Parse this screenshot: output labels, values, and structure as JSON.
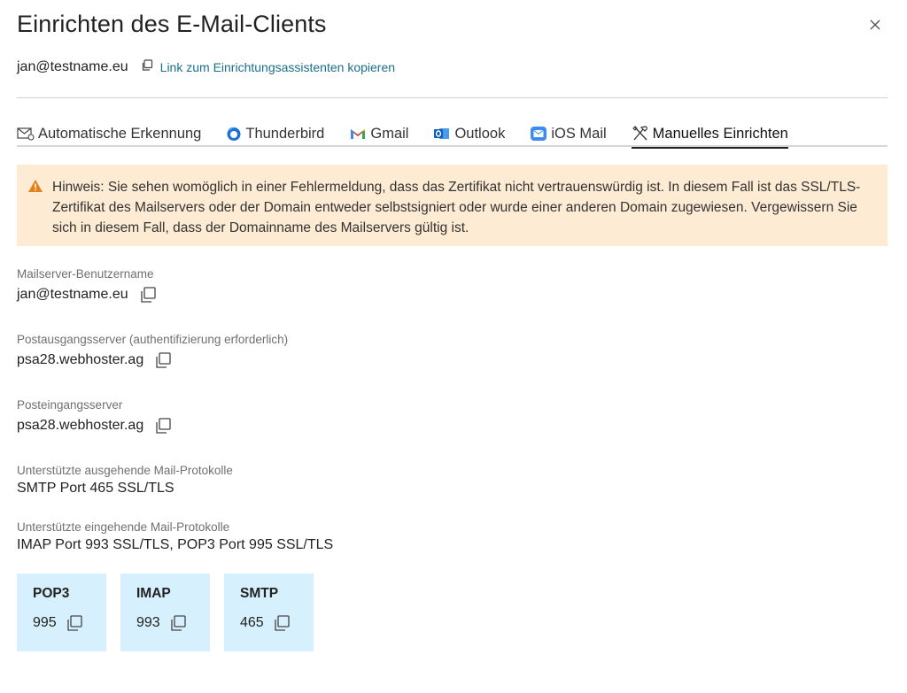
{
  "dialog": {
    "title": "Einrichten des E-Mail-Clients",
    "email": "jan@testname.eu",
    "copy_link_label": "Link zum Einrichtungsassistenten kopieren"
  },
  "tabs": [
    {
      "label": "Automatische Erkennung",
      "icon": "envelope-gear-icon",
      "active": false
    },
    {
      "label": "Thunderbird",
      "icon": "thunderbird-icon",
      "active": false
    },
    {
      "label": "Gmail",
      "icon": "gmail-icon",
      "active": false
    },
    {
      "label": "Outlook",
      "icon": "outlook-icon",
      "active": false
    },
    {
      "label": "iOS Mail",
      "icon": "ios-mail-icon",
      "active": false
    },
    {
      "label": "Manuelles Einrichten",
      "icon": "tools-icon",
      "active": true
    }
  ],
  "notice": {
    "text": "Hinweis: Sie sehen womöglich in einer Fehlermeldung, dass das Zertifikat nicht vertrauenswürdig ist. In diesem Fall ist das SSL/TLS-Zertifikat des Mailservers oder der Domain entweder selbstsigniert oder wurde einer anderen Domain zugewiesen. Vergewissern Sie sich in diesem Fall, dass der Domainname des Mailservers gültig ist.",
    "icon": "warning-icon"
  },
  "fields": {
    "username": {
      "label": "Mailserver-Benutzername",
      "value": "jan@testname.eu"
    },
    "outgoing": {
      "label": "Postausgangsserver (authentifizierung erforderlich)",
      "value": "psa28.webhoster.ag"
    },
    "incoming": {
      "label": "Posteingangsserver",
      "value": "psa28.webhoster.ag"
    },
    "out_protocols": {
      "label": "Unterstützte ausgehende Mail-Protokolle",
      "value": "SMTP Port 465 SSL/TLS"
    },
    "in_protocols": {
      "label": "Unterstützte eingehende Mail-Protokolle",
      "value": "IMAP Port 993 SSL/TLS, POP3 Port 995 SSL/TLS"
    }
  },
  "ports": [
    {
      "name": "POP3",
      "port": "995"
    },
    {
      "name": "IMAP",
      "port": "993"
    },
    {
      "name": "SMTP",
      "port": "465"
    }
  ],
  "colors": {
    "link": "#1a6f8a",
    "notice_bg": "#fdebd3",
    "warning": "#e0821c",
    "card_bg": "#d6f1fd"
  }
}
